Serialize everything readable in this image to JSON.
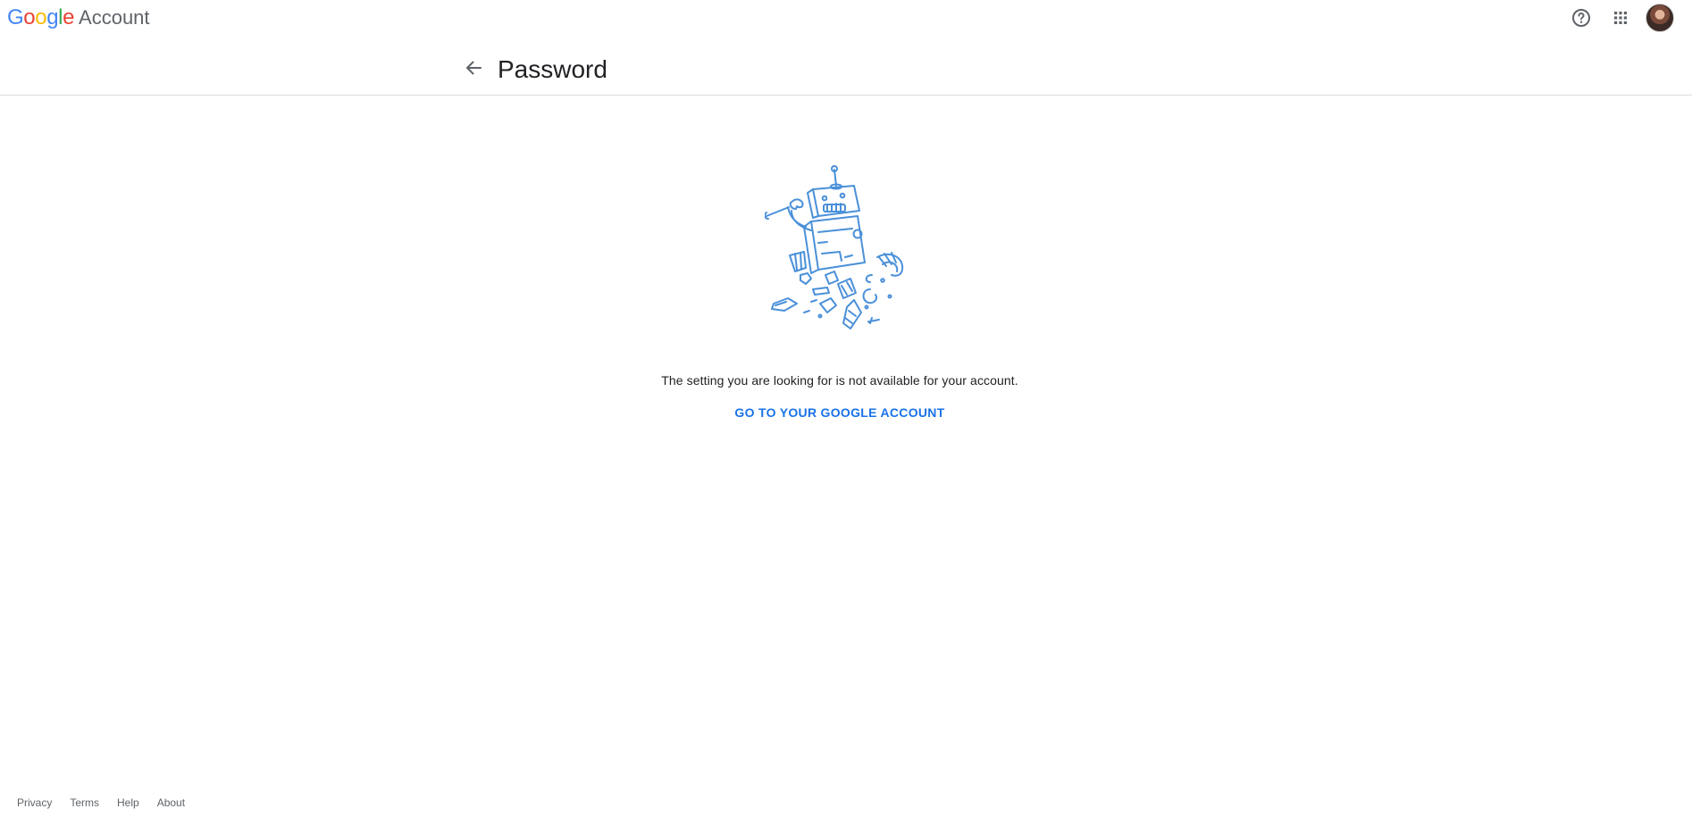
{
  "brand": {
    "google_letters": [
      "G",
      "o",
      "o",
      "g",
      "l",
      "e"
    ],
    "product": "Account",
    "letter_colors": [
      "#4285f4",
      "#ea4335",
      "#fbbc05",
      "#4285f4",
      "#34a853",
      "#ea4335"
    ]
  },
  "header_actions": {
    "help_icon": "help-circle-icon",
    "apps_icon": "apps-grid-icon",
    "avatar": "account-avatar"
  },
  "page": {
    "back_icon": "arrow-back-icon",
    "title": "Password"
  },
  "error": {
    "illustration": "broken-robot-illustration",
    "message": "The setting you are looking for is not available for your account.",
    "action_label": "GO TO YOUR GOOGLE ACCOUNT"
  },
  "footer": {
    "links": [
      "Privacy",
      "Terms",
      "Help",
      "About"
    ]
  },
  "colors": {
    "accent": "#1a73e8",
    "text": "#202124",
    "secondary_text": "#5f6368",
    "divider": "#dadce0",
    "illustration": "#4a90d9"
  }
}
